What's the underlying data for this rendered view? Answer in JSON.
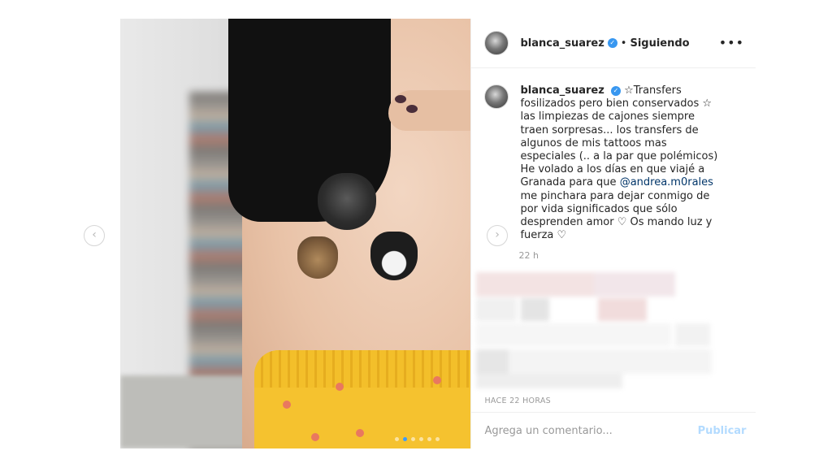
{
  "header": {
    "username": "blanca_suarez",
    "separator": "•",
    "follow_status": "Siguiendo",
    "more_label": "•••"
  },
  "caption": {
    "username": "blanca_suarez",
    "text_before": "☆Transfers fosilizados pero bien conservados ☆ las limpiezas de cajones siempre traen sorpresas... los transfers de algunos de mis tattoos mas especiales (.. a la par que polémicos) He volado a los días en que viajé a Granada para que",
    "mention": "@andrea.m0rales",
    "text_after": "me pinchara para dejar conmigo de por vida significados que sólo desprenden amor ♡ Os mando luz y fuerza ♡",
    "time": "22 h"
  },
  "timestamp": "HACE 22 HORAS",
  "comment_box": {
    "placeholder": "Agrega un comentario...",
    "publish_label": "Publicar"
  },
  "carousel": {
    "prev_icon": "‹",
    "next_icon": "›",
    "total_slides": 6,
    "active_slide": 2
  },
  "icons": {
    "verified": "✓"
  },
  "colors": {
    "verified": "#3897f0",
    "publish_disabled": "#b3dbff",
    "mention": "#003569"
  }
}
